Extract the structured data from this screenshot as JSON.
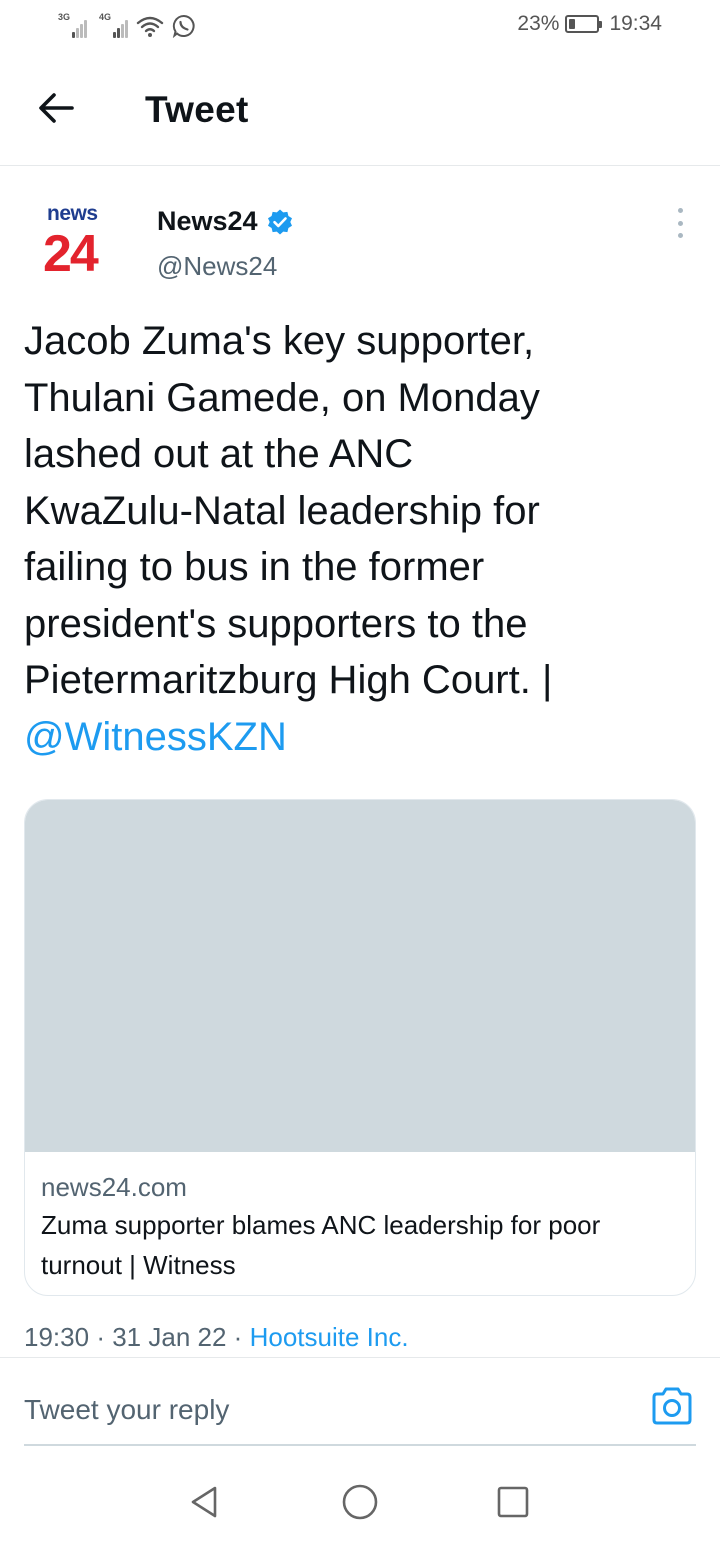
{
  "status_bar": {
    "signal1_label": "3G",
    "signal2_label": "4G",
    "battery_percent": "23%",
    "battery_level": 0.23,
    "time": "19:34",
    "icons": [
      "signal-icon",
      "signal-icon",
      "wifi-icon",
      "whatsapp-icon",
      "battery-icon"
    ]
  },
  "header": {
    "title": "Tweet",
    "back_icon": "arrow-left-icon"
  },
  "tweet": {
    "logo_top": "news",
    "logo_bottom": "24",
    "author_name": "News24",
    "author_handle": "@News24",
    "verified": true,
    "body_lines": [
      "Jacob Zuma's key supporter,",
      "Thulani Gamede, on Monday",
      "lashed out at the ANC",
      "KwaZulu-Natal leadership for",
      "failing to bus in the former",
      "president's supporters to the",
      "Pietermaritzburg High Court. |"
    ],
    "mention": "@WitnessKZN",
    "card": {
      "domain": "news24.com",
      "title": "Zuma supporter blames ANC leadership for poor turnout | Witness"
    },
    "time": "19:30",
    "separator": "·",
    "date": "31 Jan 22",
    "source": "Hootsuite Inc."
  },
  "reply": {
    "placeholder": "Tweet your reply",
    "camera_icon": "camera-icon"
  },
  "navbar": {
    "icons": [
      "back-triangle-icon",
      "home-circle-icon",
      "recents-square-icon"
    ]
  },
  "colors": {
    "accent": "#1d9bf0",
    "text": "#0f1419",
    "secondary": "#536471",
    "card_image": "#cfd9de",
    "logo_red": "#e3232d",
    "logo_blue": "#1f3d8f"
  }
}
